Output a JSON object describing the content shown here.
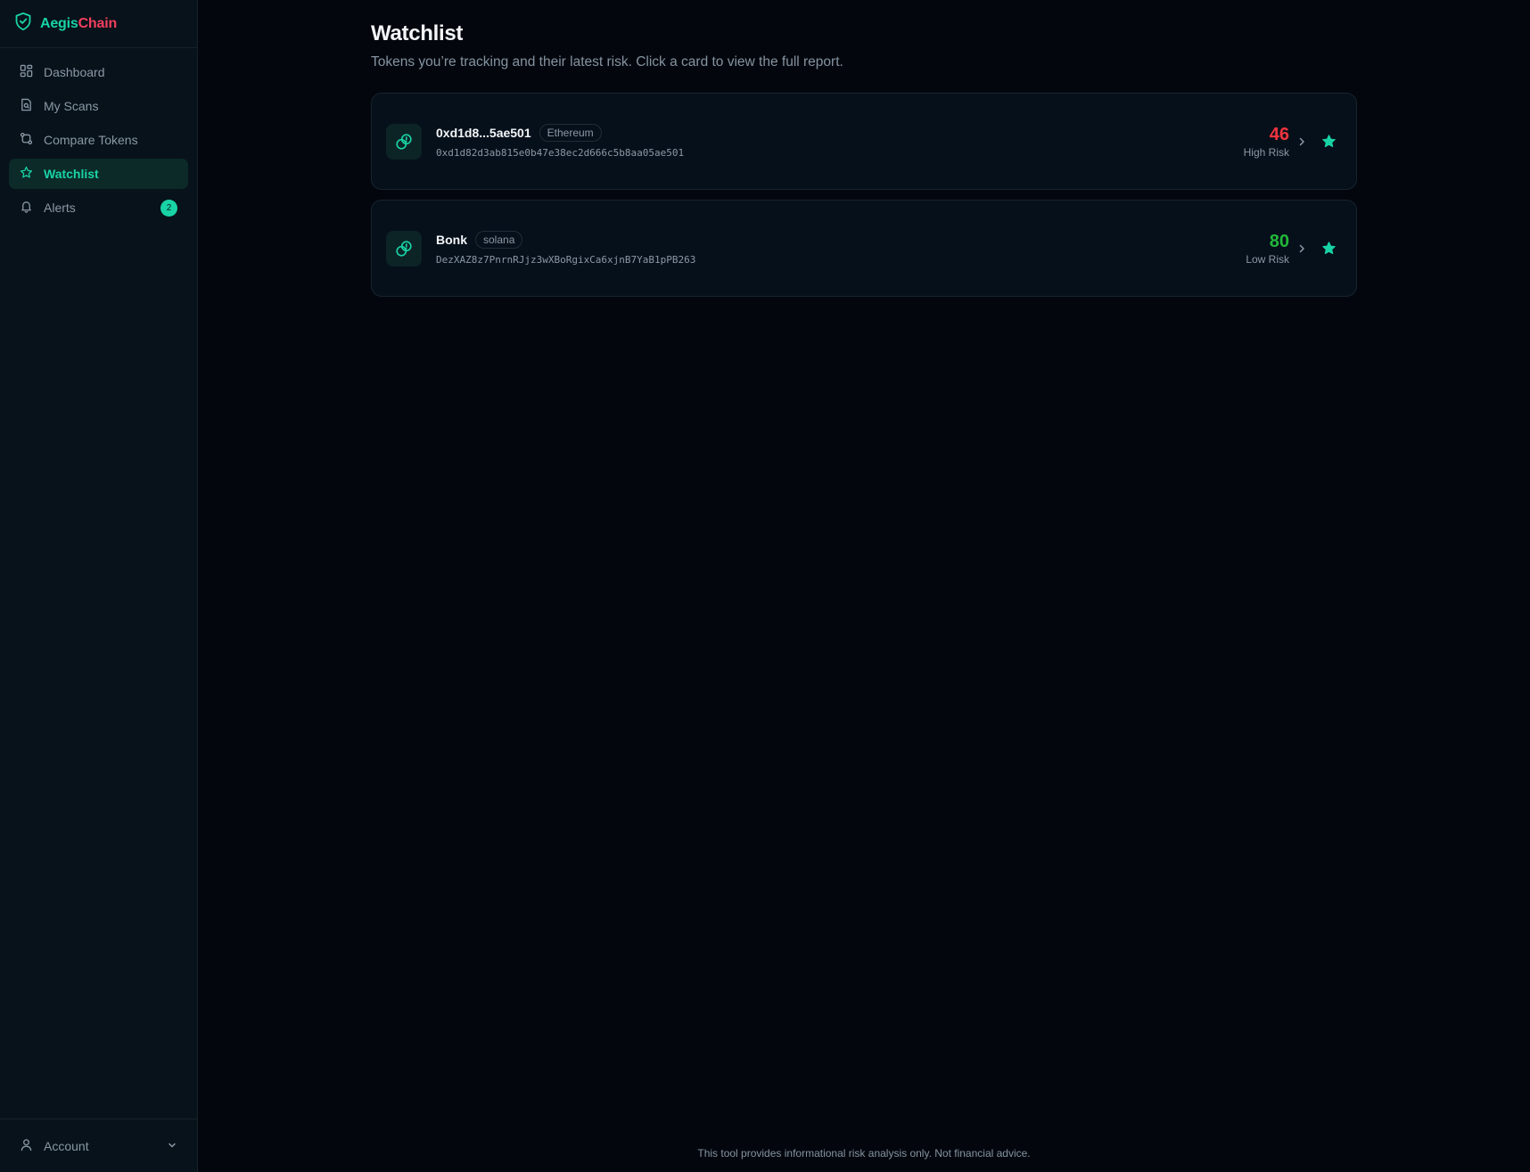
{
  "brand": {
    "name_part1": "Aegis",
    "name_part2": "Chain",
    "icon": "shield-check-icon"
  },
  "sidebar": {
    "items": [
      {
        "label": "Dashboard",
        "icon": "grid-icon",
        "active": false
      },
      {
        "label": "My Scans",
        "icon": "file-search-icon",
        "active": false
      },
      {
        "label": "Compare Tokens",
        "icon": "git-compare-icon",
        "active": false
      },
      {
        "label": "Watchlist",
        "icon": "star-icon",
        "active": true
      },
      {
        "label": "Alerts",
        "icon": "bell-icon",
        "active": false,
        "badge": "2"
      }
    ],
    "account": {
      "label": "Account",
      "icon": "user-icon"
    }
  },
  "main": {
    "title": "Watchlist",
    "subtitle": "Tokens you’re tracking and their latest risk. Click a card to view the full report.",
    "cards": [
      {
        "name": "0xd1d8...5ae501",
        "chain": "Ethereum",
        "address": "0xd1d82d3ab815e0b47e38ec2d666c5b8aa05ae501",
        "score": "46",
        "risk_label": "High Risk",
        "score_color": "#f0343f"
      },
      {
        "name": "Bonk",
        "chain": "solana",
        "address": "DezXAZ8z7PnrnRJjz3wXBoRgixCa6xjnB7YaB1pPB263",
        "score": "80",
        "risk_label": "Low Risk",
        "score_color": "#22b83a"
      }
    ]
  },
  "footer": {
    "text": "This tool provides informational risk analysis only. Not financial advice."
  },
  "colors": {
    "accent": "#19d3a6",
    "brand_red": "#f43f5e",
    "background": "#03070d"
  }
}
